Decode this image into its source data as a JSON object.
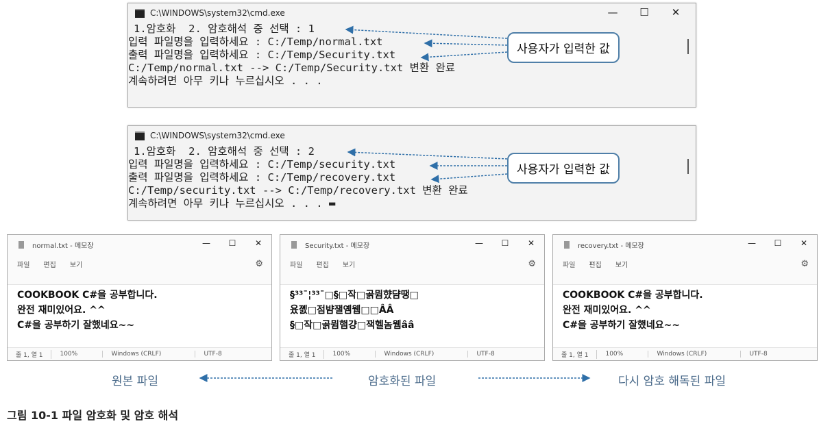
{
  "cmd1": {
    "title": "C:\\WINDOWS\\system32\\cmd.exe",
    "lines": [
      "1.암호화  2. 암호해석 중 선택 : 1",
      "입력 파일명을 입력하세요 : C:/Temp/normal.txt",
      "출력 파일명을 입력하세요 : C:/Temp/Security.txt",
      "C:/Temp/normal.txt --> C:/Temp/Security.txt 변환 완료",
      "계속하려면 아무 키나 누르십시오 . . ."
    ],
    "callout": "사용자가 입력한 값"
  },
  "cmd2": {
    "title": "C:\\WINDOWS\\system32\\cmd.exe",
    "lines": [
      "1.암호화  2. 암호해석 중 선택 : 2",
      "입력 파일명을 입력하세요 : C:/Temp/security.txt",
      "출력 파일명을 입력하세요 : C:/Temp/recovery.txt",
      "C:/Temp/security.txt --> C:/Temp/recovery.txt 변환 완료",
      "계속하려면 아무 키나 누르십시오 . . . ▬"
    ],
    "callout": "사용자가 입력한 값"
  },
  "window_buttons": {
    "minimize": "—",
    "maximize": "☐",
    "close": "✕"
  },
  "notepads": [
    {
      "title": "normal.txt - 메모장",
      "lines": [
        "COOKBOOK C#을 공부합니다.",
        "완전 재미있어요. ^^",
        "C#을 공부하기 잘했네요~~"
      ]
    },
    {
      "title": "Security.txt - 메모장",
      "lines": [
        "§³³¯¦³³¯□§□작□곩뮘햤댬땡□",
        "욨졠□점뱜잴옘웸□□ÂÂ",
        "§□작□곩뮘햄걍□잭헬놈웸ââ"
      ]
    },
    {
      "title": "recovery.txt - 메모장",
      "lines": [
        "COOKBOOK C#을 공부합니다.",
        "완전 재미있어요. ^^",
        "C#을 공부하기 잘했네요~~"
      ]
    }
  ],
  "notepad_menu": [
    "파일",
    "편집",
    "보기"
  ],
  "notepad_status": [
    "줄 1, 열 1",
    "100%",
    "Windows (CRLF)",
    "UTF-8"
  ],
  "captions": {
    "original": "원본 파일",
    "encrypted": "암호화된 파일",
    "decrypted": "다시 암호 해독된 파일"
  },
  "figure_caption": "그림 10-1 파일 암호화 및 암호 해석",
  "colors": {
    "arrow": "#2f6fa8",
    "caption": "#4a6a8a",
    "bubble_border": "#4f7fa8"
  }
}
